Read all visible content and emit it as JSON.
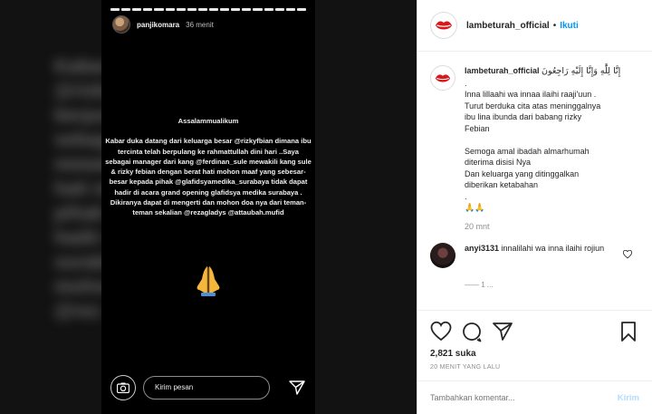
{
  "story": {
    "username": "panjikomara",
    "time": "36 menit",
    "blur_lines": [
      "Kabar ... pa besar",
      "@rizkyf ... rcinta",
      "berpulang ... Saya",
      "sebagai ... _sule",
      "mewakili kang ... berat",
      "hati mohon ... kepada",
      "pihak @glaf ... dapat",
      "hadir di acara ... medika",
      "surabaya . Di ... dan",
      "mohon doa ... kalian",
      "@rez ... ufid"
    ],
    "greeting": "Assalammualikum",
    "body": "Kabar duka datang dari keluarga besar @rizkyfbian dimana ibu tercinta telah berpulang ke rahmattullah dini hari ..Saya sebagai manager dari kang @ferdinan_sule mewakili kang sule & rizky febian dengan berat hati mohon maaf yang sebesar-besar kepada pihak @glafidsyamedika_surabaya tidak dapat hadir di acara grand opening glafidsya medika surabaya . Dikiranya dapat di mengerti dan mohon doa nya dari teman-teman sekalian @rezagladys @attaubah.mufid",
    "emoji_icon": "praying-hands",
    "message_placeholder": "Kirim pesan"
  },
  "header": {
    "username": "lambeturah_official",
    "dot": "•",
    "follow_label": "Ikuti"
  },
  "caption": {
    "username": "lambeturah_official",
    "arabic": "إِنَّا لِلَّٰهِ وَإِنَّا إِلَيْهِ رَاجِعُونَ",
    "lines": [
      ".",
      "Inna lillaahi wa innaa ilaihi raaji'uun .",
      "Turut berduka cita atas meninggalnya",
      "ibu lina ibunda dari babang rizky",
      "Febian",
      "",
      "Semoga amal ibadah almarhumah",
      "diterima disisi Nya",
      "Dan keluarga yang ditinggalkan",
      "diberikan ketabahan",
      "."
    ],
    "emoji": "🙏🙏",
    "time": "20 mnt"
  },
  "comments": [
    {
      "username": "anyi3131",
      "text": "innalilahi wa inna ilaihi rojiun"
    }
  ],
  "more_comments_text": "—— 1 ...",
  "stats": {
    "likes": "2,821 suka",
    "post_time": "20 MENIT YANG LALU"
  },
  "comment_box": {
    "placeholder": "Tambahkan komentar...",
    "post_label": "Kirim"
  },
  "colors": {
    "link_blue": "#0095f6",
    "post_disabled": "#b3dbff",
    "story_bg": "#000000",
    "logo_red": "#d7191b"
  }
}
